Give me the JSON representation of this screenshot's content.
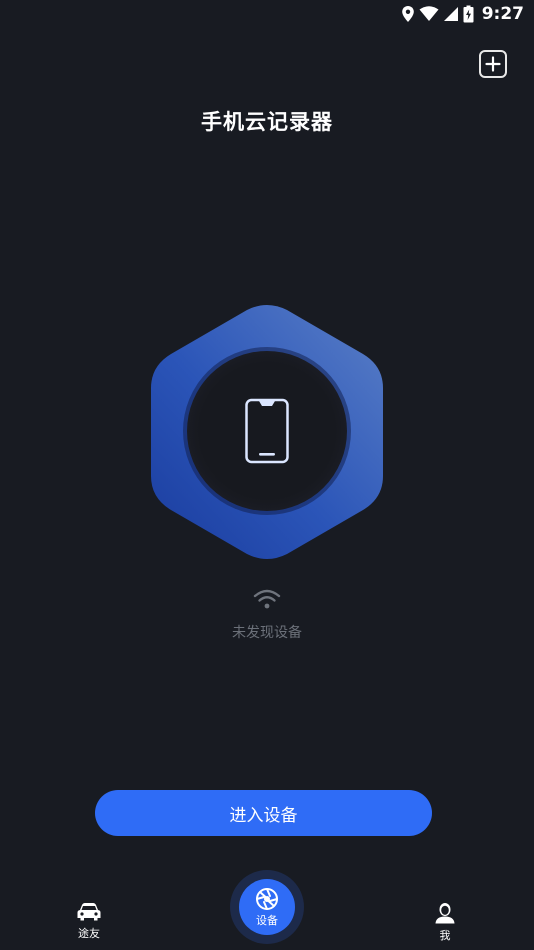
{
  "status_bar": {
    "time": "9:27"
  },
  "header": {
    "title": "手机云记录器"
  },
  "device_area": {
    "status_text": "未发现设备"
  },
  "main": {
    "enter_button_label": "进入设备"
  },
  "bottom_nav": {
    "items": [
      {
        "label": "途友",
        "icon": "car-icon"
      },
      {
        "label": "设备",
        "icon": "camera-shutter-icon"
      },
      {
        "label": "我",
        "icon": "profile-icon"
      }
    ]
  },
  "colors": {
    "background": "#181b22",
    "accent": "#2f6cf6",
    "hex_light": "#4f78c6",
    "hex_dark": "#1c43a8",
    "muted_text": "#6b7079"
  }
}
